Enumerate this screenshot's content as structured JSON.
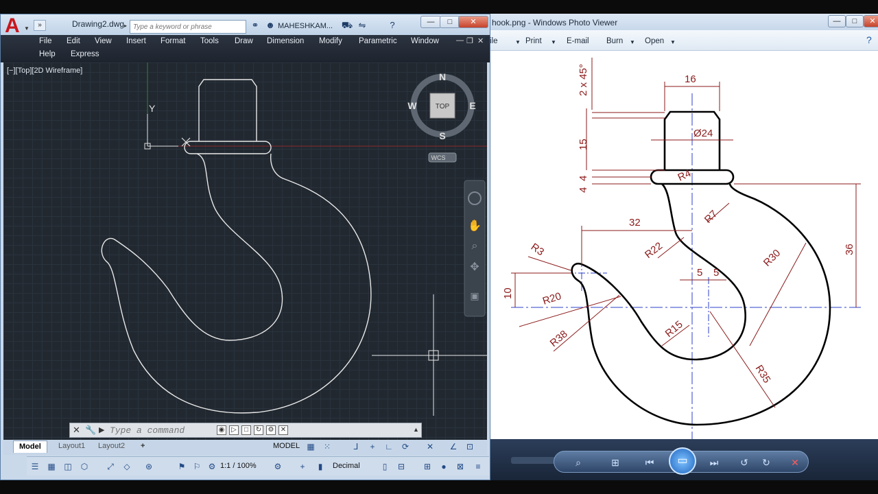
{
  "autocad": {
    "logo": "A",
    "drawing_name": "Drawing2.dwg",
    "search_placeholder": "Type a keyword or phrase",
    "user": "MAHESHKAM...",
    "menu": [
      "File",
      "Edit",
      "View",
      "Insert",
      "Format",
      "Tools",
      "Draw",
      "Dimension",
      "Modify",
      "Parametric",
      "Window",
      "Help",
      "Express"
    ],
    "viewport_label": "[−][Top][2D Wireframe]",
    "viewcube": {
      "north": "N",
      "south": "S",
      "east": "E",
      "west": "W",
      "face": "TOP",
      "ucs": "WCS"
    },
    "ucs_axis": "Y",
    "command_placeholder": "Type a command",
    "tabs": [
      "Model",
      "Layout1",
      "Layout2",
      "+"
    ],
    "status_model": "MODEL",
    "scale": "1:1 / 100%",
    "units": "Decimal"
  },
  "viewer": {
    "title": "hook.png - Windows Photo Viewer",
    "toolbar": [
      "File",
      "Print",
      "E-mail",
      "Burn",
      "Open"
    ],
    "dimensions": {
      "chamfer": "2 x 45°",
      "top_width": "16",
      "diameter": "Ø24",
      "height_15": "15",
      "gap_4a": "4",
      "gap_4b": "4",
      "r4": "R4",
      "r7": "R7",
      "width_32": "32",
      "r3": "R3",
      "r22": "R22",
      "r30": "R30",
      "height_36": "36",
      "offset_5a": "5",
      "offset_5b": "5",
      "height_10": "10",
      "r20": "R20",
      "r15": "R15",
      "r38": "R38",
      "r35": "R35"
    }
  },
  "colors": {
    "autocad_bg": "#212830",
    "dimension": "#8b1a1a",
    "centerline": "#2b3fc9"
  }
}
